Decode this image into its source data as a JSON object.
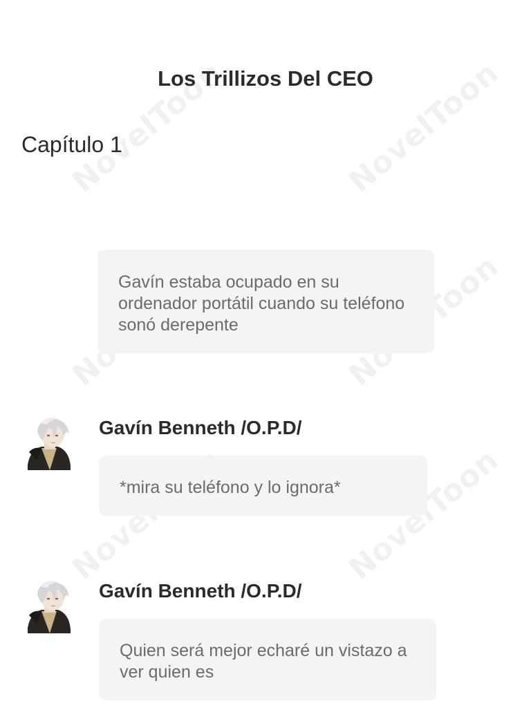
{
  "story": {
    "title": "Los Trillizos Del CEO",
    "chapter": "Capítulo 1"
  },
  "watermark": {
    "text": "NovelToon"
  },
  "narration": {
    "text": "Gavín estaba ocupado en su ordenador portátil cuando su teléfono sonó derepente"
  },
  "messages": [
    {
      "speaker": "Gavín Benneth /O.P.D/",
      "text": "*mira su teléfono y lo ignora*",
      "avatar_icon": "character-avatar-icon"
    },
    {
      "speaker": "Gavín Benneth /O.P.D/",
      "text": "Quien será mejor echaré un vistazo a ver quien es",
      "avatar_icon": "character-avatar-icon"
    }
  ],
  "colors": {
    "bubble_bg": "#f4f4f4",
    "bubble_text": "#6b6b6b",
    "heading_text": "#2b2b2b",
    "background": "#ffffff"
  }
}
